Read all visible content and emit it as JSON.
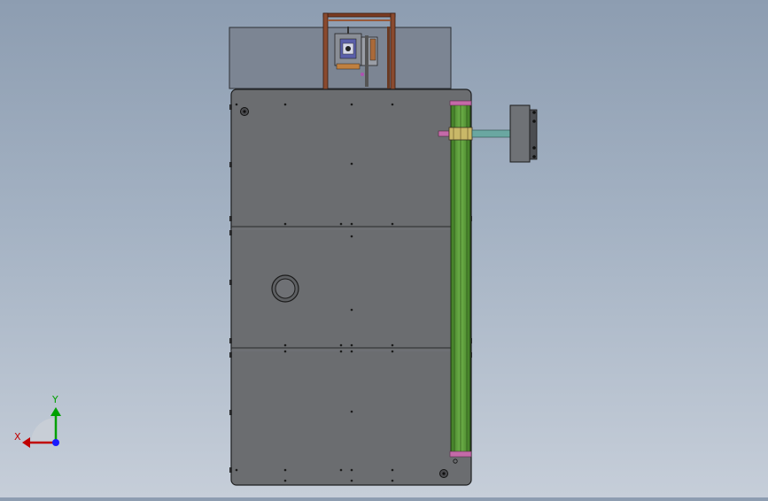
{
  "viewport": {
    "background_top": "#8d9db1",
    "background_bottom": "#c6ced9"
  },
  "model": {
    "panel_color": "#6b6d70",
    "panel_outline": "#1e1f20",
    "top_plate_color": "#7c8593",
    "frame_color": "#7a3b22",
    "rail_color": "#5e9c3a",
    "rail_end_color": "#c46aa8",
    "bracket_color": "#6f7276",
    "rod_color": "#6aa7a1",
    "bolt_color": "#1b1b1b"
  },
  "triad": {
    "x_label": "X",
    "y_label": "Y",
    "x_color": "#c00000",
    "y_color": "#00a000",
    "z_color": "#1a1aff",
    "plane_color": "#c9ced6"
  }
}
